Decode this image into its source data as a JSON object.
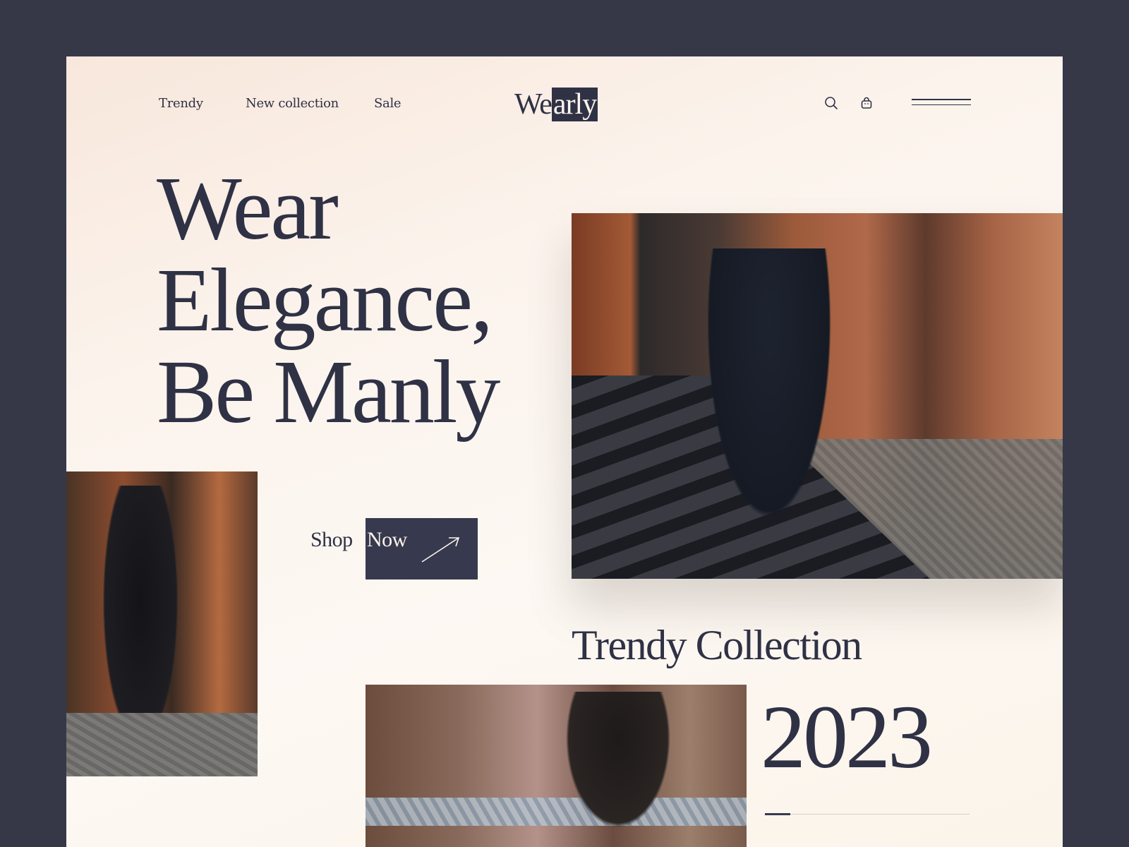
{
  "nav": {
    "links": [
      "Trendy",
      "New collection",
      "Sale"
    ]
  },
  "logo": {
    "part1": "We",
    "part2": "arly"
  },
  "header_icons": [
    "search-icon",
    "bag-icon",
    "menu-icon"
  ],
  "hero": {
    "line1": "Wear",
    "line2": "Elegance,",
    "line3": "Be Manly"
  },
  "cta": {
    "label_part1": "Shop",
    "label_part2": "Now"
  },
  "collection": {
    "title": "Trendy Collection",
    "year": "2023"
  },
  "colors": {
    "background": "#363848",
    "page": "#fbf3ec",
    "accent": "#373a4e"
  }
}
